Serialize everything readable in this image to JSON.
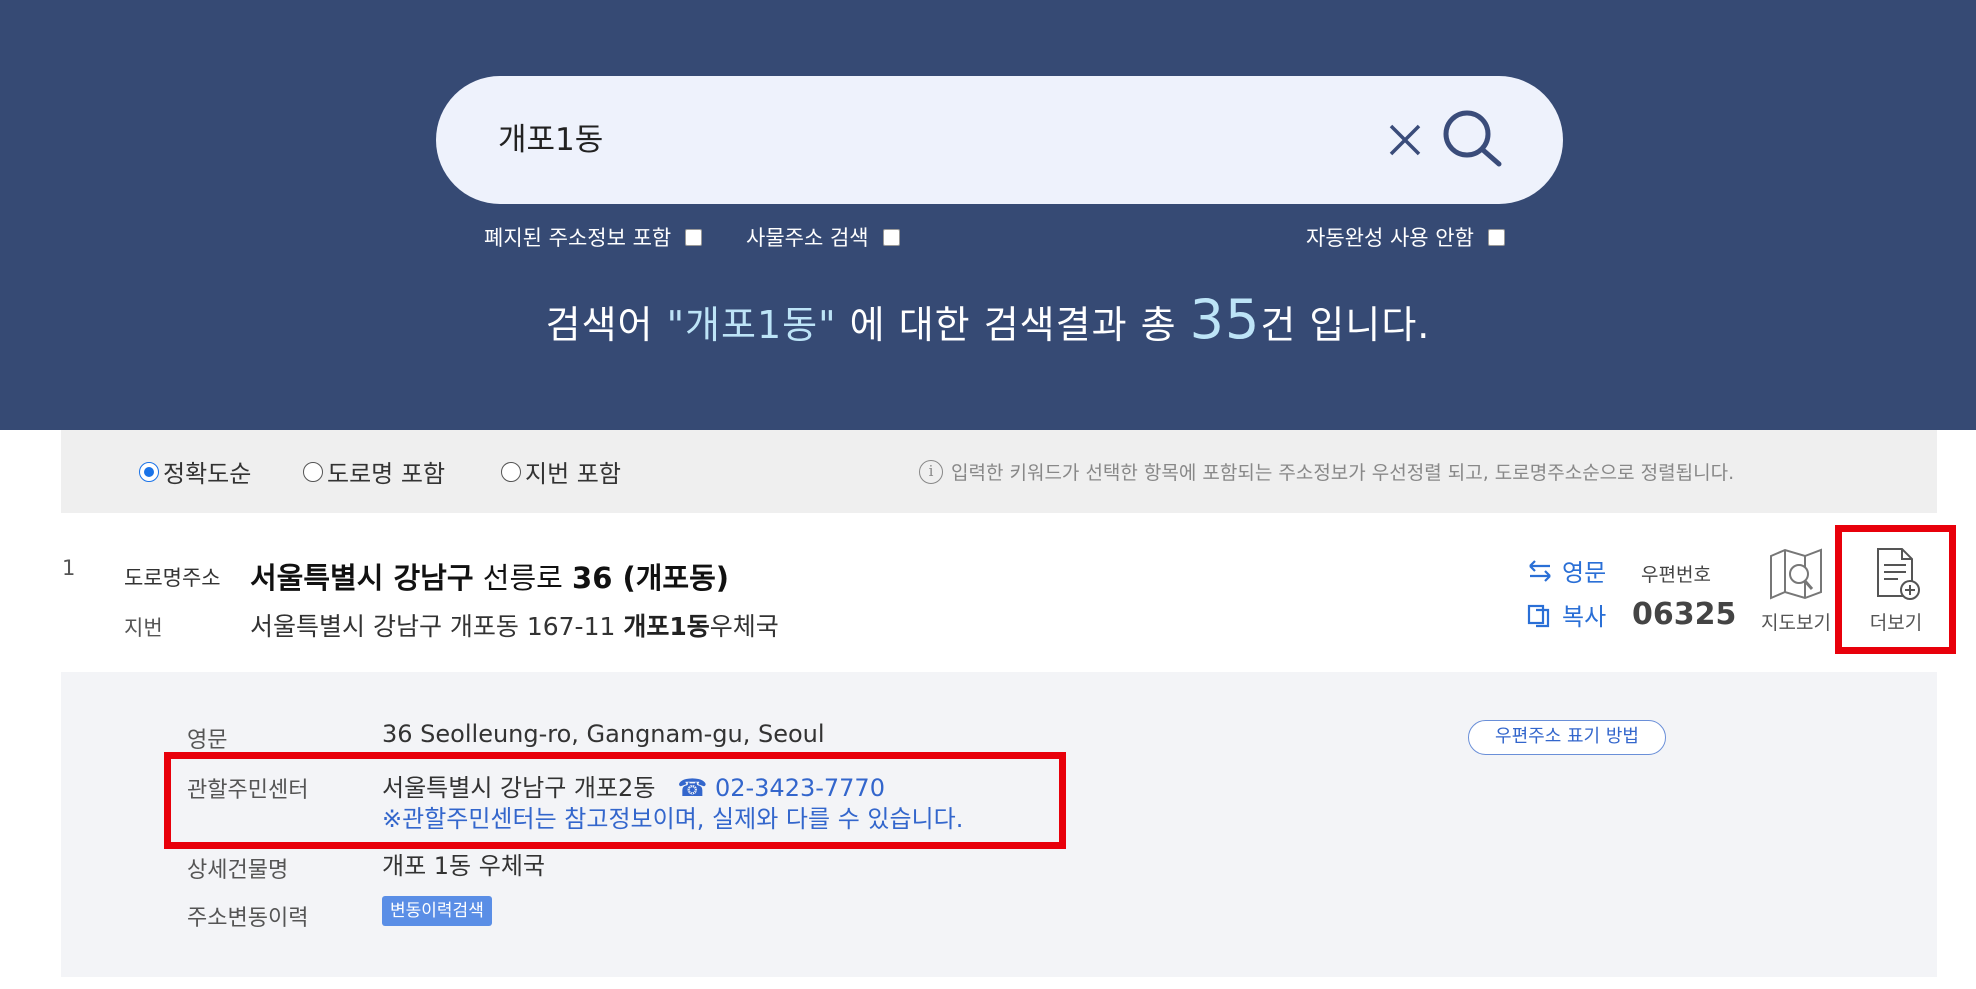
{
  "search": {
    "value": "개포1동"
  },
  "options": {
    "include_abolished": "폐지된 주소정보 포함",
    "thing_address": "사물주소 검색",
    "no_autocomplete": "자동완성 사용 안함"
  },
  "result_summary": {
    "prefix": "검색어 ",
    "keyword": "\"개포1동\"",
    "middle": " 에 대한 검색결과 총 ",
    "count": "35",
    "suffix": "건 입니다."
  },
  "sort": {
    "options": [
      "정확도순",
      "도로명 포함",
      "지번 포함"
    ],
    "selected": "정확도순",
    "info": "입력한 키워드가 선택한 항목에 포함되는 주소정보가 우선정렬 되고, 도로명주소순으로 정렬됩니다."
  },
  "result": {
    "number": "1",
    "road_label": "도로명주소",
    "road_bold": "서울특별시 강남구",
    "road_rest": " 선릉로 ",
    "road_num": "36 (개포동)",
    "jibun_label": "지번",
    "jibun_text": "서울특별시 강남구 개포동 167-11 ",
    "jibun_bold": "개포1동",
    "jibun_suffix": "우체국",
    "english_btn": "영문",
    "copy_btn": "복사",
    "zip_label": "우편번호",
    "zip_value": "06325",
    "map_btn": "지도보기",
    "more_btn": "더보기"
  },
  "detail": {
    "english_label": "영문",
    "english_value": "36 Seolleung-ro, Gangnam-gu, Seoul",
    "center_label": "관할주민센터",
    "center_value": "서울특별시 강남구 개포2동",
    "center_phone": "02-3423-7770",
    "center_note": "※관할주민센터는 참고정보이며, 실제와 다를 수 있습니다.",
    "building_label": "상세건물명",
    "building_value": "개포 1동 우체국",
    "history_label": "주소변동이력",
    "history_btn": "변동이력검색",
    "postal_btn": "우편주소 표기 방법"
  },
  "colors": {
    "header_bg": "#364a74",
    "accent": "#2a6fd6",
    "highlight_box": "#e8000b"
  }
}
